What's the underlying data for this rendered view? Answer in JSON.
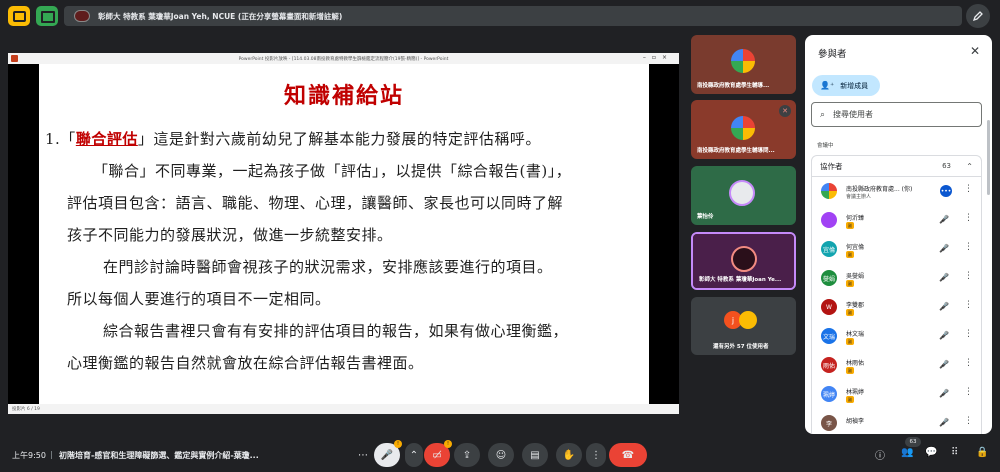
{
  "topbar": {
    "share_text": "彰師大 特教系 葉瓊華Joan Yeh, NCUE (正在分享螢幕畫面和新增註解)"
  },
  "presentation": {
    "window_title": "PowerPoint 投影片放映 - [114.03.08南投教育處特教學生篩檢鑑定流程簡介(19張-精簡)] - PowerPoint",
    "status_text": "投影片 6 / 19",
    "slide_title": "知識補給站",
    "lines": [
      {
        "prefix": "1.「",
        "highlight": "聯合評估",
        "suffix": "」這是針對六歲前幼兒了解基本能力發展的特定評估稱呼。"
      },
      {
        "text": "「聯合」不同專業，一起為孩子做「評估」，以提供「綜合報告(書)」，"
      },
      {
        "text": "評估項目包含：語言、職能、物理、心理，讓醫師、家長也可以同時了解"
      },
      {
        "text": "孩子不同能力的發展狀況，做進一步統整安排。"
      },
      {
        "text": "在門診討論時醫師會視孩子的狀況需求，安排應該要進行的項目。"
      },
      {
        "text": "所以每個人要進行的項目不一定相同。"
      },
      {
        "text": "綜合報告書裡只會有有安排的評估項目的報告，如果有做心理衡鑑，"
      },
      {
        "text": "心理衡鑑的報告自然就會放在綜合評估報告書裡面。"
      }
    ]
  },
  "tiles": [
    {
      "label": "南投縣政府教育處學生輔導...",
      "bg": "#7a3b2e"
    },
    {
      "label": "南投縣政府教育處學生輔導問...",
      "bg": "#8a3a2b"
    },
    {
      "label": "葉怡伶",
      "bg": "#2e6b47"
    },
    {
      "label": "彰師大 特教系 葉瓊華Joan Ye...",
      "bg": "#4a1f4a"
    },
    {
      "label": "還有另外 57 位使用者",
      "bg": "#3c4043"
    }
  ],
  "panel": {
    "title": "參與者",
    "add_label": "新增成員",
    "search_placeholder": "搜尋使用者",
    "section_label": "會議中",
    "collab_label": "協作者",
    "collab_count": "63",
    "participants": [
      {
        "name": "南投縣政府教育處...",
        "you": "(你)",
        "sub": "會議主辦人",
        "color": "#f4b400",
        "initial": "",
        "host": true
      },
      {
        "name": "何沂臻",
        "color": "#a142f4",
        "initial": "何"
      },
      {
        "name": "何宜倫",
        "color": "#12a4af",
        "initial": "宜倫"
      },
      {
        "name": "吳燮娟",
        "color": "#1e8e3e",
        "initial": "燮娟"
      },
      {
        "name": "李雙郡",
        "color": "#b31412",
        "initial": "W"
      },
      {
        "name": "林文瑞",
        "color": "#1a73e8",
        "initial": "文瑞"
      },
      {
        "name": "林雨佑",
        "color": "#c5221f",
        "initial": "雨佑"
      },
      {
        "name": "林珮婷",
        "color": "#4285f4",
        "initial": "珮婷"
      },
      {
        "name": "胡禎李",
        "color": "#795548",
        "initial": "李"
      }
    ],
    "badge": "副"
  },
  "bottombar": {
    "time": "上午9:50",
    "meeting_title": "初階培育-感官和生理障礙篩選、鑑定與實例介紹-葉瓊...",
    "people_count": "63",
    "mic_badge": "!",
    "cam_badge": "!"
  }
}
